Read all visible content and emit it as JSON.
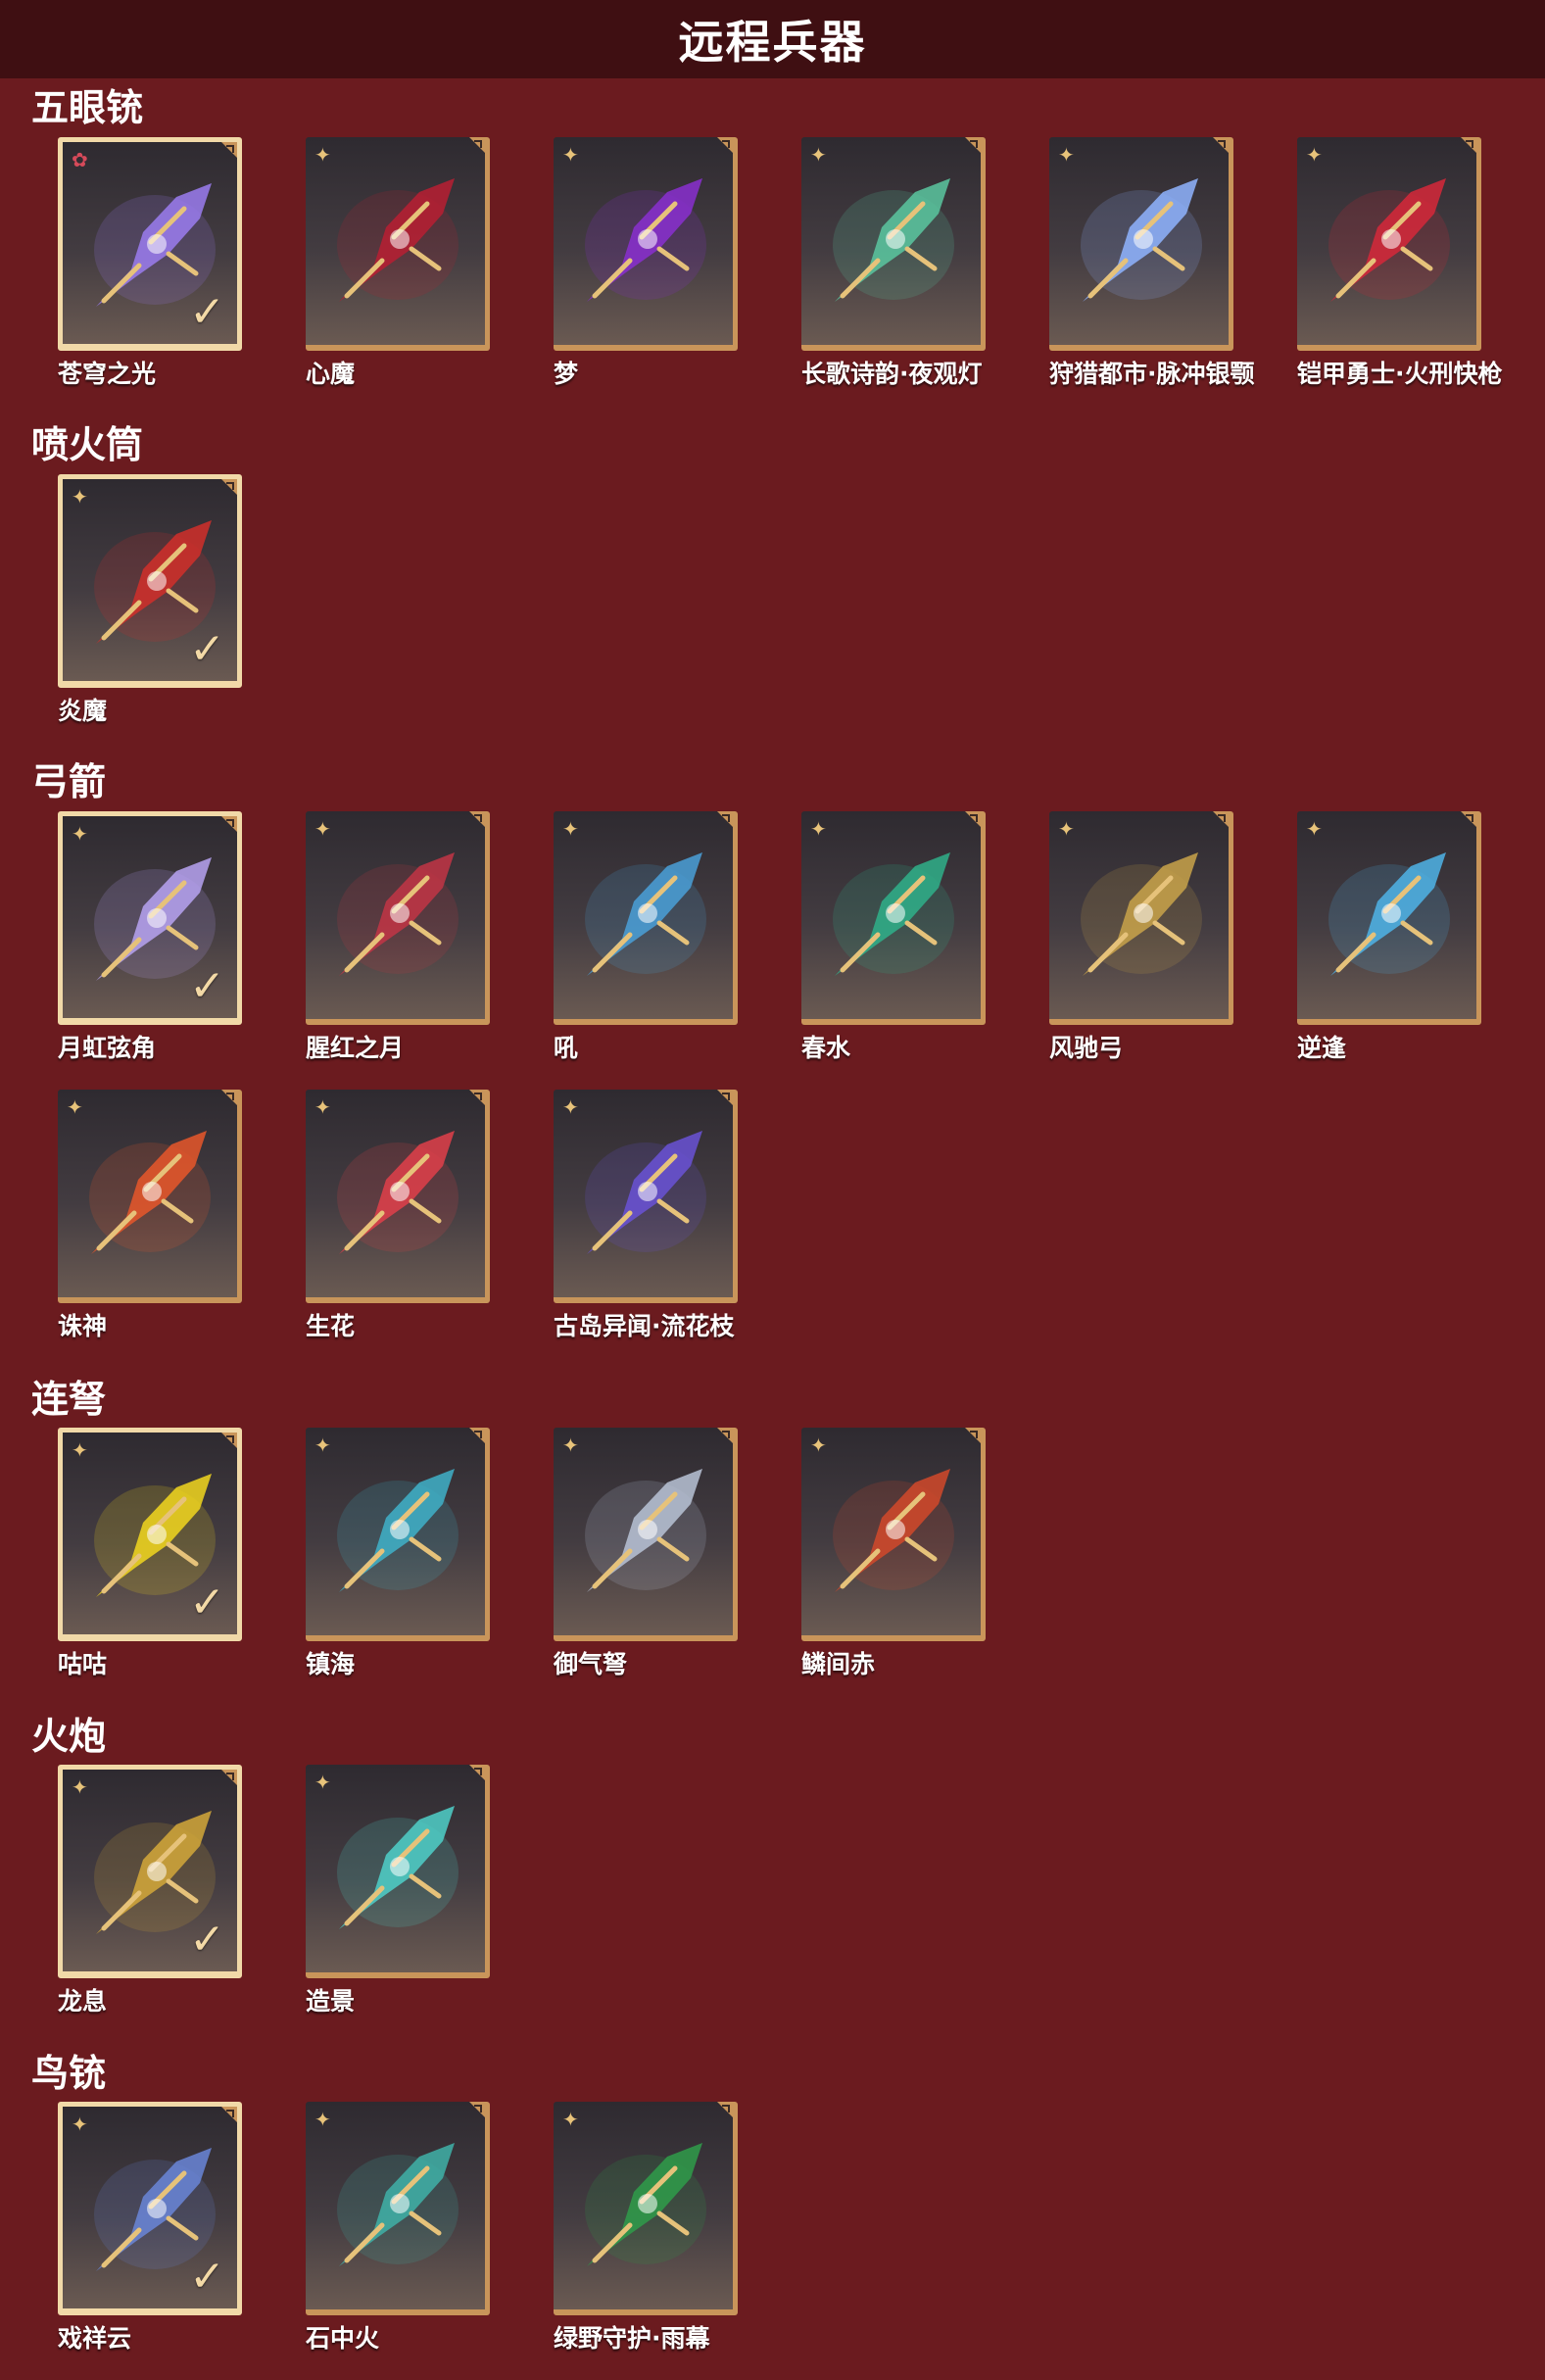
{
  "page": {
    "title": "远程兵器"
  },
  "colors": {
    "background": "#6b1b1f",
    "title_bar": "#3f0f12",
    "card_border": "#c9955a",
    "selected_border": "#f1d9a8",
    "quality_gold": "#e8c37a",
    "quality_red": "#d64a5a"
  },
  "categories": [
    {
      "title": "五眼铳",
      "items": [
        {
          "name": "苍穹之光",
          "selected": true,
          "quality": "red",
          "icon": "energy-gauntlet-icon",
          "accent": "#9b7cf0"
        },
        {
          "name": "心魔",
          "selected": false,
          "quality": "gold",
          "icon": "dark-gauntlet-icon",
          "accent": "#b81f33"
        },
        {
          "name": "梦",
          "selected": false,
          "quality": "gold",
          "icon": "violet-gauntlet-icon",
          "accent": "#8a2fd0"
        },
        {
          "name": "长歌诗韵·夜观灯",
          "selected": false,
          "quality": "gold",
          "icon": "lantern-gun-icon",
          "accent": "#5bc7a0"
        },
        {
          "name": "狩猎都市·脉冲银颚",
          "selected": false,
          "quality": "gold",
          "icon": "pulse-jaw-icon",
          "accent": "#8fb4ff"
        },
        {
          "name": "铠甲勇士·火刑快枪",
          "selected": false,
          "quality": "gold",
          "icon": "red-blaster-icon",
          "accent": "#d6283a"
        }
      ]
    },
    {
      "title": "喷火筒",
      "items": [
        {
          "name": "炎魔",
          "selected": true,
          "quality": "gold",
          "icon": "flame-cannon-icon",
          "accent": "#d12f2a"
        }
      ]
    },
    {
      "title": "弓箭",
      "items": [
        {
          "name": "月虹弦角",
          "selected": true,
          "quality": "gold",
          "icon": "moon-bow-icon",
          "accent": "#b7a3f2"
        },
        {
          "name": "腥红之月",
          "selected": false,
          "quality": "gold",
          "icon": "crimson-bow-icon",
          "accent": "#c23545"
        },
        {
          "name": "吼",
          "selected": false,
          "quality": "gold",
          "icon": "roar-bow-icon",
          "accent": "#4aa0d8"
        },
        {
          "name": "春水",
          "selected": false,
          "quality": "gold",
          "icon": "jade-bow-icon",
          "accent": "#2fb08a"
        },
        {
          "name": "风驰弓",
          "selected": false,
          "quality": "gold",
          "icon": "wind-bow-icon",
          "accent": "#c9a34a"
        },
        {
          "name": "逆逢",
          "selected": false,
          "quality": "gold",
          "icon": "azure-bow-icon",
          "accent": "#4fb4e8"
        },
        {
          "name": "诛神",
          "selected": false,
          "quality": "gold",
          "icon": "fire-bow-icon",
          "accent": "#e8572a"
        },
        {
          "name": "生花",
          "selected": false,
          "quality": "gold",
          "icon": "blossom-bow-icon",
          "accent": "#e0404a"
        },
        {
          "name": "古岛异闻·流花枝",
          "selected": false,
          "quality": "gold",
          "icon": "night-bow-icon",
          "accent": "#6a52d6"
        }
      ]
    },
    {
      "title": "连弩",
      "items": [
        {
          "name": "咕咕",
          "selected": true,
          "quality": "gold",
          "icon": "chicken-crossbow-icon",
          "accent": "#f2d71e"
        },
        {
          "name": "镇海",
          "selected": false,
          "quality": "gold",
          "icon": "sea-crossbow-icon",
          "accent": "#3fb1c9"
        },
        {
          "name": "御气弩",
          "selected": false,
          "quality": "gold",
          "icon": "silver-crossbow-icon",
          "accent": "#b9c3d6"
        },
        {
          "name": "鳞间赤",
          "selected": false,
          "quality": "gold",
          "icon": "carp-crossbow-icon",
          "accent": "#d2492a"
        }
      ]
    },
    {
      "title": "火炮",
      "items": [
        {
          "name": "龙息",
          "selected": true,
          "quality": "gold",
          "icon": "dragon-cannon-icon",
          "accent": "#d4a83a"
        },
        {
          "name": "造景",
          "selected": false,
          "quality": "gold",
          "icon": "jade-cannon-icon",
          "accent": "#4fd0c9"
        }
      ]
    },
    {
      "title": "鸟铳",
      "items": [
        {
          "name": "戏祥云",
          "selected": true,
          "quality": "gold",
          "icon": "cloud-musket-icon",
          "accent": "#6a86d8"
        },
        {
          "name": "石中火",
          "selected": false,
          "quality": "gold",
          "icon": "stone-musket-icon",
          "accent": "#3fb1a8"
        },
        {
          "name": "绿野守护·雨幕",
          "selected": false,
          "quality": "gold",
          "icon": "green-musket-icon",
          "accent": "#2f9c4a"
        }
      ]
    }
  ]
}
